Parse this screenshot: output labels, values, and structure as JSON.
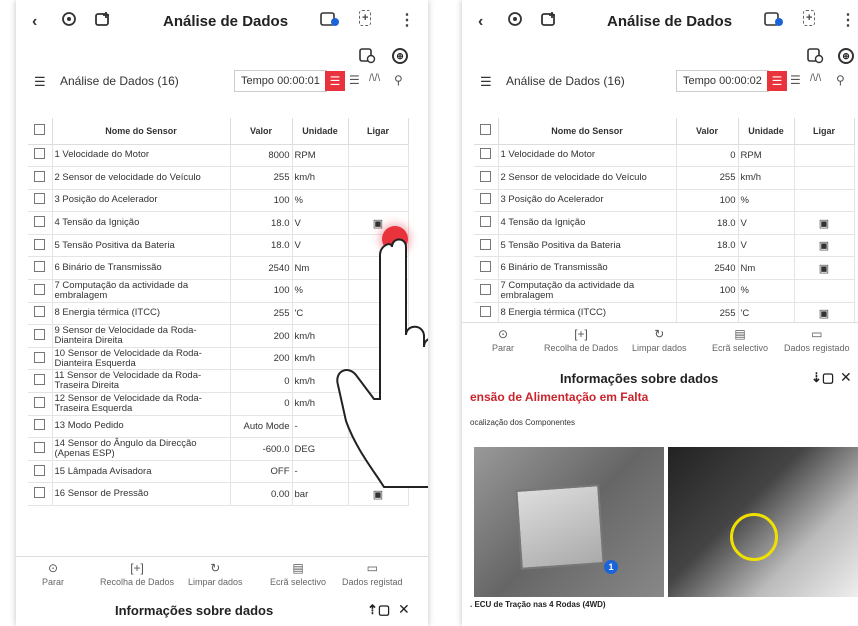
{
  "left": {
    "title": "Análise de Dados",
    "list_title": "Análise de Dados (16)",
    "time": "Tempo 00:00:01",
    "columns": {
      "name": "Nome do Sensor",
      "value": "Valor",
      "unit": "Unidade",
      "link": "Ligar"
    },
    "rows": [
      {
        "n": "1 Velocidade do Motor",
        "v": "8000",
        "u": "RPM",
        "l": ""
      },
      {
        "n": "2 Sensor de velocidade do Veículo",
        "v": "255",
        "u": "km/h",
        "l": ""
      },
      {
        "n": "3 Posição do Acelerador",
        "v": "100",
        "u": "%",
        "l": ""
      },
      {
        "n": "4 Tensão da Ignição",
        "v": "18.0",
        "u": "V",
        "l": "link-icon"
      },
      {
        "n": "5 Tensão Positiva da Bateria",
        "v": "18.0",
        "u": "V",
        "l": ""
      },
      {
        "n": "6 Binário de Transmissão",
        "v": "2540",
        "u": "Nm",
        "l": ""
      },
      {
        "n": "7 Computação da actividade da embralagem",
        "v": "100",
        "u": "%",
        "l": ""
      },
      {
        "n": "8 Energia térmica (ITCC)",
        "v": "255",
        "u": "'C",
        "l": ""
      },
      {
        "n": "9 Sensor de Velocidade da Roda-Dianteira Direita",
        "v": "200",
        "u": "km/h",
        "l": ""
      },
      {
        "n": "10 Sensor de Velocidade da Roda-Dianteira Esquerda",
        "v": "200",
        "u": "km/h",
        "l": ""
      },
      {
        "n": "11 Sensor de Velocidade da Roda-Traseira Direita",
        "v": "0",
        "u": "km/h",
        "l": ""
      },
      {
        "n": "12 Sensor de Velocidade da Roda-Traseira Esquerda",
        "v": "0",
        "u": "km/h",
        "l": ""
      },
      {
        "n": "13 Modo Pedido",
        "v": "Auto Mode",
        "u": "-",
        "l": ""
      },
      {
        "n": "14 Sensor do Ângulo da Direcção (Apenas ESP)",
        "v": "-600.0",
        "u": "DEG",
        "l": ""
      },
      {
        "n": "15 Lâmpada Avisadora",
        "v": "OFF",
        "u": "-",
        "l": ""
      },
      {
        "n": "16 Sensor de Pressão",
        "v": "0.00",
        "u": "bar",
        "l": "link-icon"
      }
    ],
    "nav": [
      "Parar",
      "Recolha de Dados",
      "Limpar dados",
      "Ecrã selectivo",
      "Dados registad"
    ],
    "info_title": "Informações sobre dados"
  },
  "right": {
    "title": "Análise de Dados",
    "list_title": "Análise de Dados (16)",
    "time": "Tempo 00:00:02",
    "columns": {
      "name": "Nome do Sensor",
      "value": "Valor",
      "unit": "Unidade",
      "link": "Ligar"
    },
    "rows": [
      {
        "n": "1 Velocidade do Motor",
        "v": "0",
        "u": "RPM",
        "l": ""
      },
      {
        "n": "2 Sensor de velocidade do Veículo",
        "v": "255",
        "u": "km/h",
        "l": ""
      },
      {
        "n": "3 Posição do Acelerador",
        "v": "100",
        "u": "%",
        "l": ""
      },
      {
        "n": "4 Tensão da Ignição",
        "v": "18.0",
        "u": "V",
        "l": "link-icon"
      },
      {
        "n": "5 Tensão Positiva da Bateria",
        "v": "18.0",
        "u": "V",
        "l": "link-icon"
      },
      {
        "n": "6 Binário de Transmissão",
        "v": "2540",
        "u": "Nm",
        "l": "link-icon"
      },
      {
        "n": "7 Computação da actividade da embralagem",
        "v": "100",
        "u": "%",
        "l": ""
      },
      {
        "n": "8 Energia térmica (ITCC)",
        "v": "255",
        "u": "'C",
        "l": "link-icon"
      }
    ],
    "nav": [
      "Parar",
      "Recolha de Dados",
      "Limpar dados",
      "Ecrã selectivo",
      "Dados registado"
    ],
    "info_title": "Informações sobre dados",
    "fault_title": "ensão de Alimentação em Falta",
    "component_label": "ocalização dos Componentes",
    "photo_badge": "1",
    "caption": ". ECU de Tração nas 4 Rodas (4WD)"
  },
  "colors": {
    "accent": "#e8323c",
    "fault": "#c9252c",
    "badge": "#1b63d8"
  }
}
